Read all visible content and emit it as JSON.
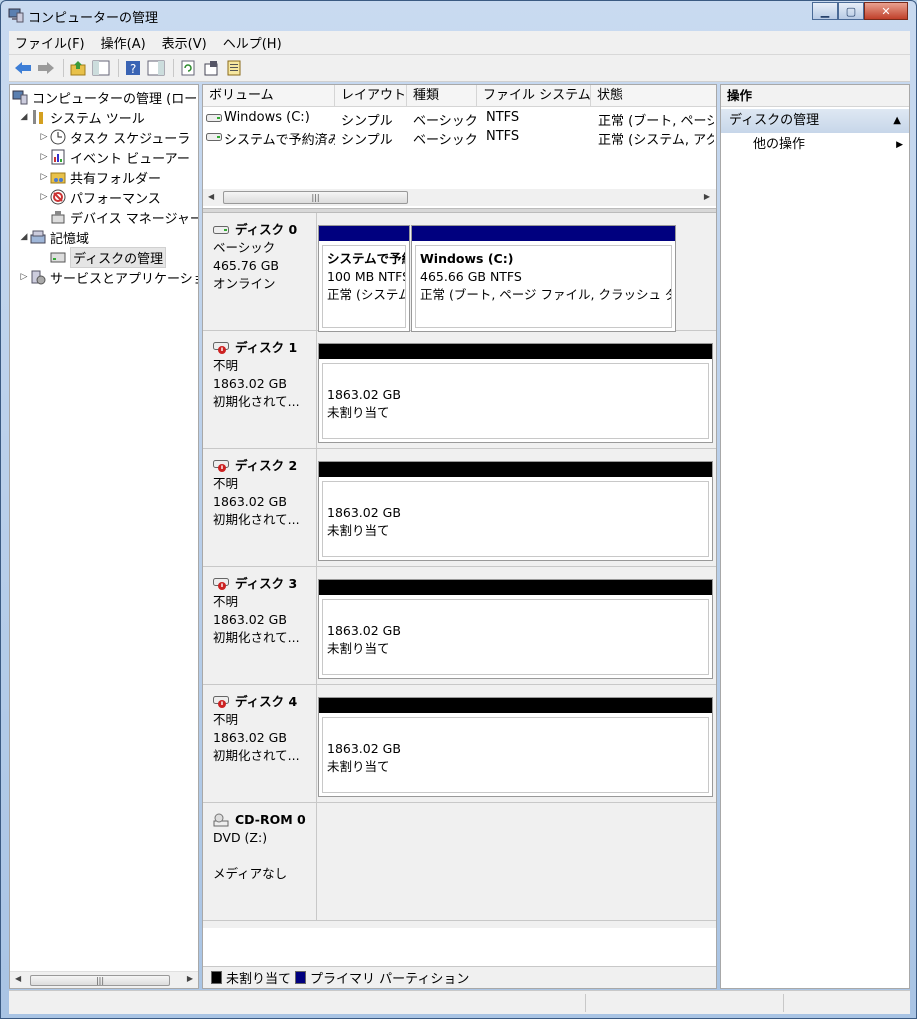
{
  "window": {
    "title": "コンピューターの管理"
  },
  "menu": [
    "ファイル(F)",
    "操作(A)",
    "表示(V)",
    "ヘルプ(H)"
  ],
  "tree": {
    "root": "コンピューターの管理 (ローカル)",
    "system_tools": "システム ツール",
    "task_scheduler": "タスク スケジューラ",
    "event_viewer": "イベント ビューアー",
    "shared_folders": "共有フォルダー",
    "performance": "パフォーマンス",
    "device_manager": "デバイス マネージャー",
    "storage": "記憶域",
    "disk_management": "ディスクの管理",
    "services": "サービスとアプリケーション"
  },
  "volume_list": {
    "columns": [
      "ボリューム",
      "レイアウト",
      "種類",
      "ファイル システム",
      "状態"
    ],
    "rows": [
      {
        "volume": "Windows (C:)",
        "layout": "シンプル",
        "type": "ベーシック",
        "fs": "NTFS",
        "status": "正常 (ブート, ページ"
      },
      {
        "volume": "システムで予約済み",
        "layout": "シンプル",
        "type": "ベーシック",
        "fs": "NTFS",
        "status": "正常 (システム, アク"
      }
    ]
  },
  "disks": [
    {
      "name": "ディスク 0",
      "type": "ベーシック",
      "size": "465.76 GB",
      "state": "オンライン",
      "partitions": [
        {
          "title": "システムで予約",
          "size": "100 MB NTFS",
          "status": "正常 (システム"
        },
        {
          "title": "Windows  (C:)",
          "size": "465.66 GB NTFS",
          "status": "正常 (ブート, ページ ファイル, クラッシュ ダ"
        }
      ]
    },
    {
      "name": "ディスク 1",
      "type": "不明",
      "size": "1863.02 GB",
      "state": "初期化されて...",
      "partitions": [
        {
          "size": "1863.02 GB",
          "status": "未割り当て"
        }
      ]
    },
    {
      "name": "ディスク 2",
      "type": "不明",
      "size": "1863.02 GB",
      "state": "初期化されて...",
      "partitions": [
        {
          "size": "1863.02 GB",
          "status": "未割り当て"
        }
      ]
    },
    {
      "name": "ディスク 3",
      "type": "不明",
      "size": "1863.02 GB",
      "state": "初期化されて...",
      "partitions": [
        {
          "size": "1863.02 GB",
          "status": "未割り当て"
        }
      ]
    },
    {
      "name": "ディスク 4",
      "type": "不明",
      "size": "1863.02 GB",
      "state": "初期化されて...",
      "partitions": [
        {
          "size": "1863.02 GB",
          "status": "未割り当て"
        }
      ]
    },
    {
      "name": "CD-ROM 0",
      "type": "DVD (Z:)",
      "size": "",
      "state": "メディアなし"
    }
  ],
  "legend": {
    "unallocated": "未割り当て",
    "primary": "プライマリ パーティション"
  },
  "actions": {
    "header": "操作",
    "section": "ディスクの管理",
    "item": "他の操作"
  },
  "colors": {
    "primary": "#00007f",
    "unallocated": "#000000",
    "accent": "#c7d6e9"
  }
}
